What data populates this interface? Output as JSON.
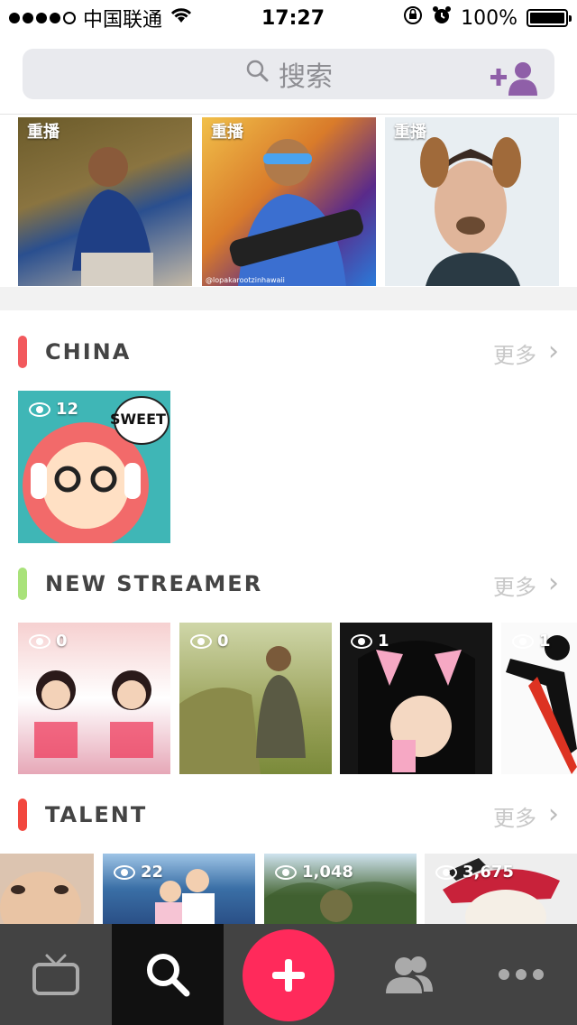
{
  "status_bar": {
    "carrier": "中国联通",
    "time": "17:27",
    "battery": "100%"
  },
  "search": {
    "placeholder": "搜索"
  },
  "replay_row": {
    "items": [
      {
        "tag": "重播"
      },
      {
        "tag": "重播"
      },
      {
        "tag": "重播"
      }
    ]
  },
  "sections": [
    {
      "title": "CHINA",
      "more": "更多",
      "accent": "#f2595d",
      "items": [
        {
          "views": "12"
        }
      ]
    },
    {
      "title": "NEW STREAMER",
      "more": "更多",
      "accent": "#a9e27a",
      "items": [
        {
          "views": "0"
        },
        {
          "views": "0"
        },
        {
          "views": "1"
        },
        {
          "views": "1"
        }
      ]
    },
    {
      "title": "TALENT",
      "more": "更多",
      "accent": "#f2473e",
      "items": [
        {
          "views": ""
        },
        {
          "views": "22"
        },
        {
          "views": "1,048"
        },
        {
          "views": "3,675"
        }
      ]
    }
  ],
  "thumb_badges": {
    "sweet": "SWEET",
    "watermark": "@lopakarootzinhawaii"
  },
  "tabbar": {
    "tabs": [
      "tv-icon",
      "search-icon",
      "plus-icon",
      "friends-icon",
      "more-icon"
    ],
    "plus_color": "#ff2a5b"
  }
}
